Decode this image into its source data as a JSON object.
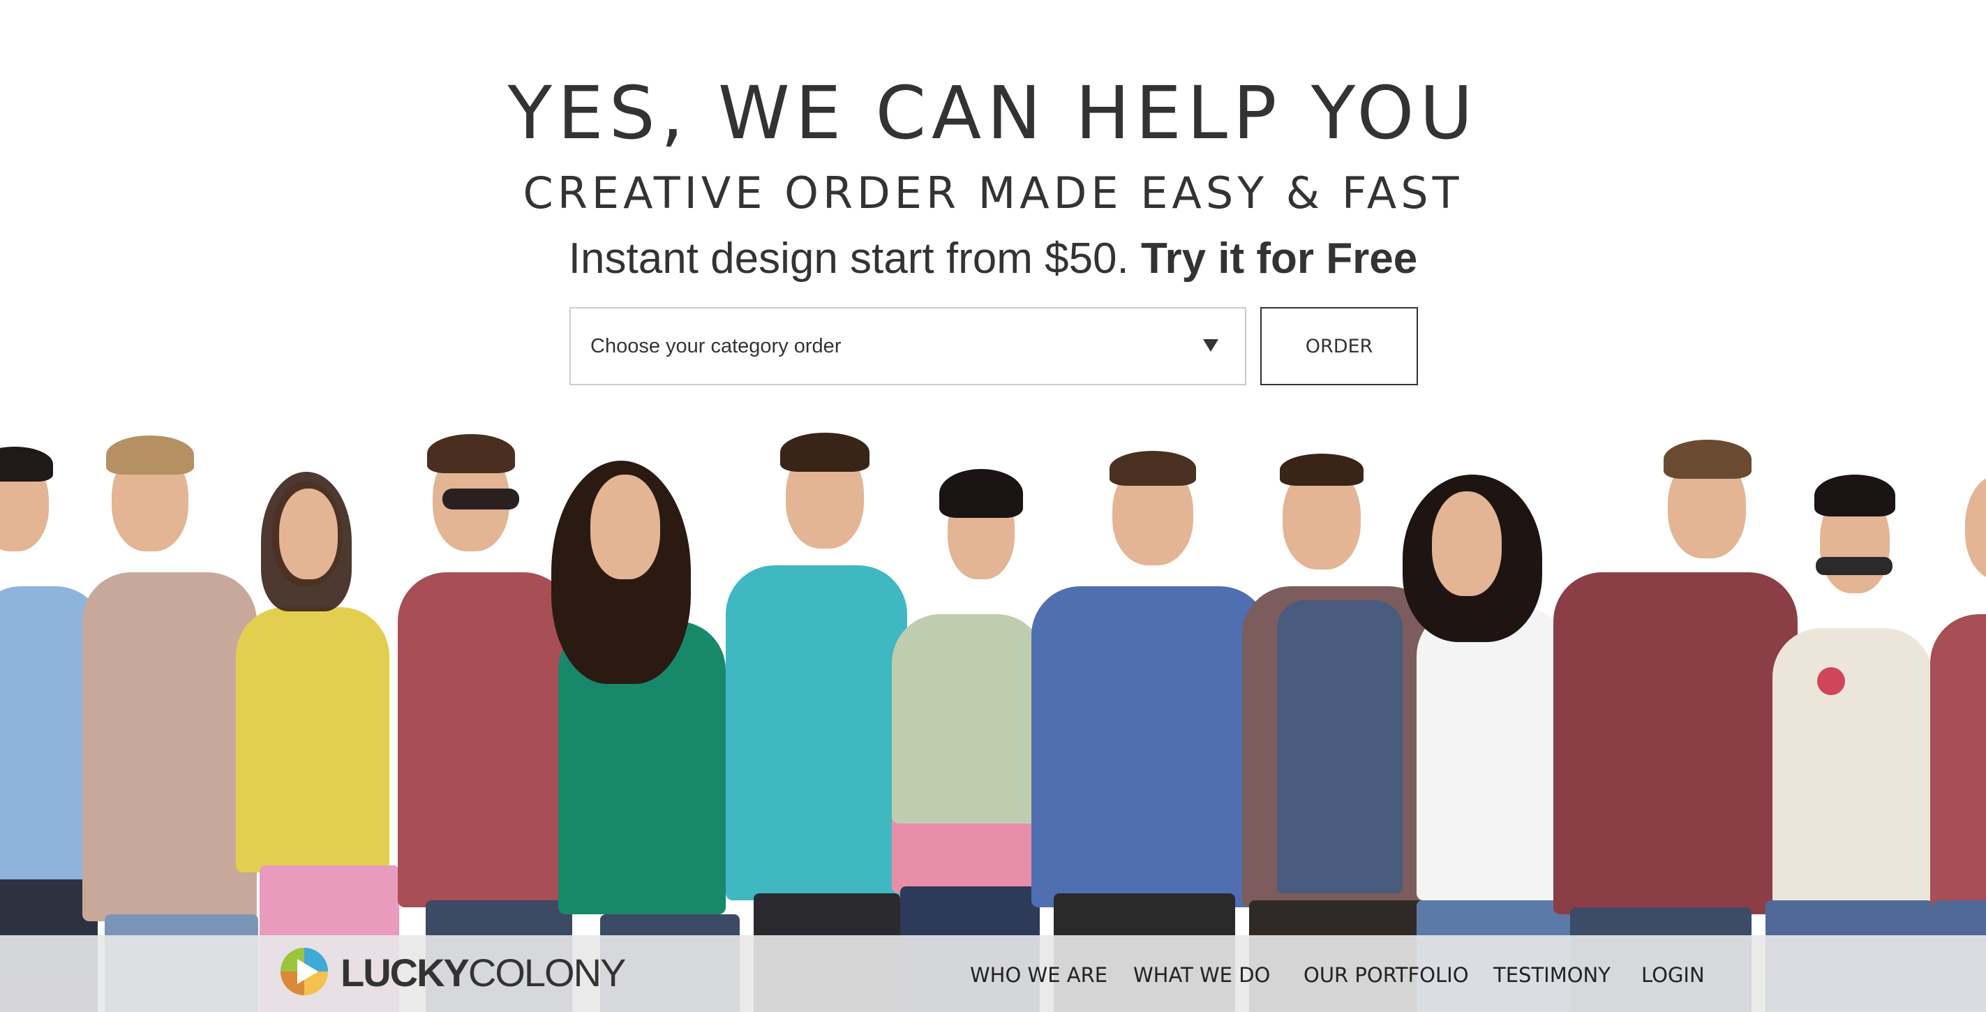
{
  "hero": {
    "headline": "YES, WE CAN HELP YOU",
    "subheadline": "CREATIVE ORDER MADE EASY & FAST",
    "tagline_prefix": "Instant design start from $50.",
    "tagline_cta": "Try it for Free"
  },
  "order_form": {
    "category_select_value": "Choose your category order",
    "order_button_label": "ORDER"
  },
  "brand": {
    "name_part1": "LUCKY",
    "name_part2": "COLONY",
    "logo_icon": "play-triangle-icon"
  },
  "nav": {
    "items": [
      {
        "label": "WHO WE ARE"
      },
      {
        "label": "WHAT WE DO"
      },
      {
        "label": "OUR PORTFOLIO"
      },
      {
        "label": "TESTIMONY"
      },
      {
        "label": "LOGIN"
      }
    ]
  },
  "colors": {
    "text": "#333333",
    "navbar_bg": "#e8e8e8",
    "logo_green": "#9bc53d",
    "logo_blue": "#3fa9d8",
    "logo_yellow": "#f2c14e",
    "logo_orange": "#e57e3a"
  }
}
